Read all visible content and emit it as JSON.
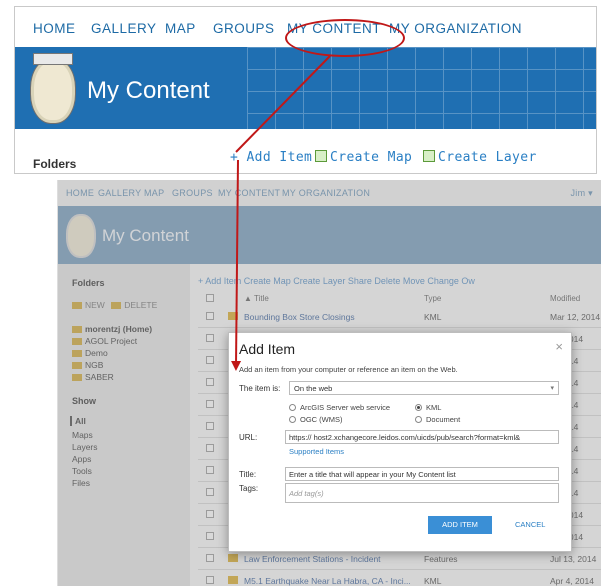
{
  "zoom": {
    "nav": [
      "HOME",
      "GALLERY",
      "MAP",
      "GROUPS",
      "MY CONTENT",
      "MY ORGANIZATION"
    ],
    "title": "My Content",
    "folders": "Folders",
    "toolbar": {
      "add": "+ Add Item",
      "map": "Create Map",
      "layer": "Create Layer"
    }
  },
  "shot": {
    "nav": [
      "HOME",
      "GALLERY",
      "MAP",
      "GROUPS",
      "MY CONTENT",
      "MY ORGANIZATION"
    ],
    "user": "Jim ▾",
    "title": "My Content",
    "sidebar": {
      "folders": "Folders",
      "new": "NEW",
      "delete": "DELETE",
      "items": [
        "morentzj (Home)",
        "AGOL Project",
        "Demo",
        "NGB",
        "SABER"
      ],
      "show": "Show",
      "filters": [
        "All",
        "Maps",
        "Layers",
        "Apps",
        "Tools",
        "Files"
      ]
    },
    "toolbar": "+ Add Item  Create Map  Create Layer  Share  Delete  Move  Change Ow",
    "columns": {
      "title": "▲ Title",
      "type": "Type",
      "modified": "Modified"
    },
    "rows": [
      {
        "name": "Bounding Box Store Closings",
        "type": "KML",
        "mod": "Mar 12, 2014"
      },
      {
        "name": "",
        "type": "",
        "mod": "12, 2014"
      },
      {
        "name": "",
        "type": "",
        "mod": "5, 2014"
      },
      {
        "name": "",
        "type": "",
        "mod": "7, 2014"
      },
      {
        "name": "",
        "type": "",
        "mod": "3, 2014"
      },
      {
        "name": "",
        "type": "",
        "mod": "8, 2014"
      },
      {
        "name": "",
        "type": "",
        "mod": "7, 2014"
      },
      {
        "name": "",
        "type": "",
        "mod": "4, 2014"
      },
      {
        "name": "",
        "type": "",
        "mod": "4, 2014"
      },
      {
        "name": "",
        "type": "",
        "mod": "23, 2014"
      },
      {
        "name": "",
        "type": "",
        "mod": "30, 2014"
      },
      {
        "name": "Law Enforcement Stations - Incident",
        "type": "Features",
        "mod": "Jul 13, 2014"
      },
      {
        "name": "M5.1 Earthquake Near La Habra, CA - Inci...",
        "type": "KML",
        "mod": "Apr 4, 2014"
      }
    ]
  },
  "dialog": {
    "title": "Add Item",
    "close": "×",
    "description": "Add an item from your computer or reference an item on the Web.",
    "item_is_label": "The item is:",
    "item_is_value": "On the web",
    "radios": [
      "ArcGIS Server web service",
      "KML",
      "OGC (WMS)",
      "Document"
    ],
    "selected_radio": "KML",
    "url_label": "URL:",
    "url_value": "https:// host2.xchangecore.leidos.com/uicds/pub/search?format=kml&",
    "supported": "Supported Items",
    "title_label": "Title:",
    "title_value": "Enter a title that will appear in your My Content list",
    "tags_label": "Tags:",
    "tags_placeholder": "Add tag(s)",
    "add_button": "ADD ITEM",
    "cancel": "CANCEL"
  },
  "colors": {
    "banner": "#1f6fb2",
    "link": "#2a7fc4",
    "highlight": "#c01818",
    "button": "#3a8fd6"
  }
}
